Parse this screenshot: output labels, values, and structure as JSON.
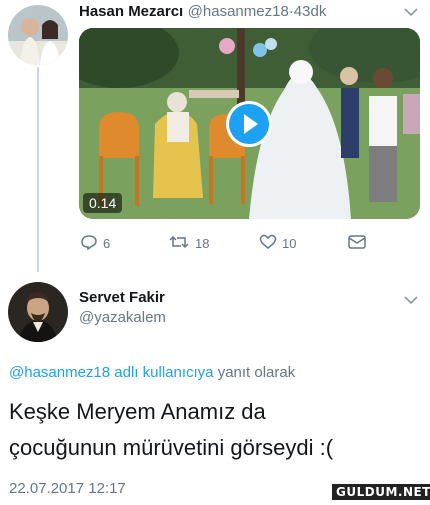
{
  "tweet1": {
    "name": "Hasan Mezarcı",
    "handle": "@hasanmez18",
    "dot": "·",
    "time": "43dk",
    "video_duration": "0.14",
    "actions": {
      "reply_count": "6",
      "retweet_count": "18",
      "like_count": "10"
    }
  },
  "tweet2": {
    "name": "Servet Fakir",
    "handle": "@yazakalem",
    "reply_link": "@hasanmez18 adlı kullanıcıya",
    "reply_suffix": "yanıt olarak",
    "text_line1": "Keşke Meryem Anamız da",
    "text_line2": "çocuğunun mürüvetini görseydi :(",
    "date": "22.07.2017 12:17"
  },
  "watermark": "GULDUM.NET",
  "colors": {
    "link": "#1da1f2",
    "secondary": "#657786",
    "primary_text": "#14171a",
    "play_blue": "#1da1f2"
  }
}
